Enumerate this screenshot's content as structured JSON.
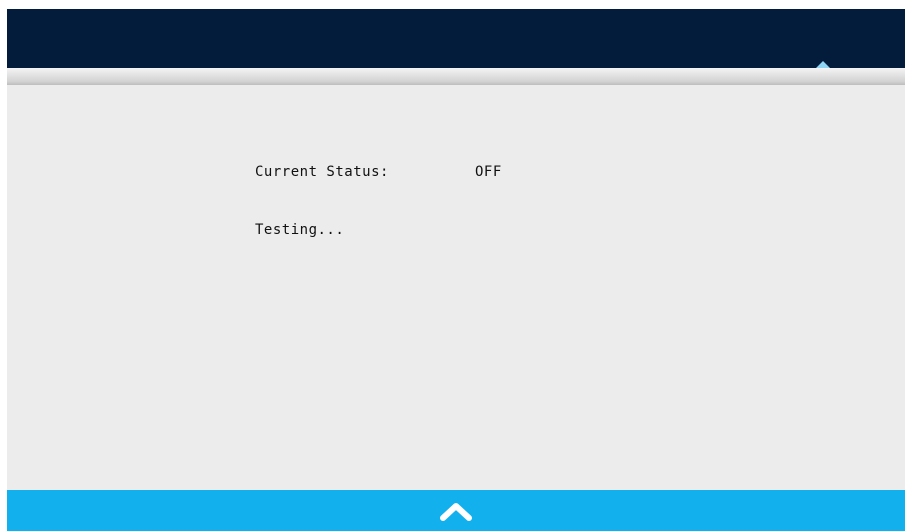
{
  "toolbar": {
    "icons": [
      {
        "name": "card-icon",
        "color": "#3fc83a"
      },
      {
        "name": "device-icon",
        "color": "#3fc83a"
      },
      {
        "name": "refresh-icon",
        "color": "#3fc83a"
      },
      {
        "name": "eye-icon",
        "color": "#3fc83a",
        "active": true
      },
      {
        "name": "usb-icon",
        "color": "#3fc83a"
      }
    ],
    "background": "#041c3c",
    "active_marker_color": "#8fd6f5"
  },
  "status": {
    "label": "Current Status:",
    "value": "OFF"
  },
  "message": "Testing...",
  "footer": {
    "background": "#12b1ee",
    "button_icon": "chevron-up-icon"
  }
}
